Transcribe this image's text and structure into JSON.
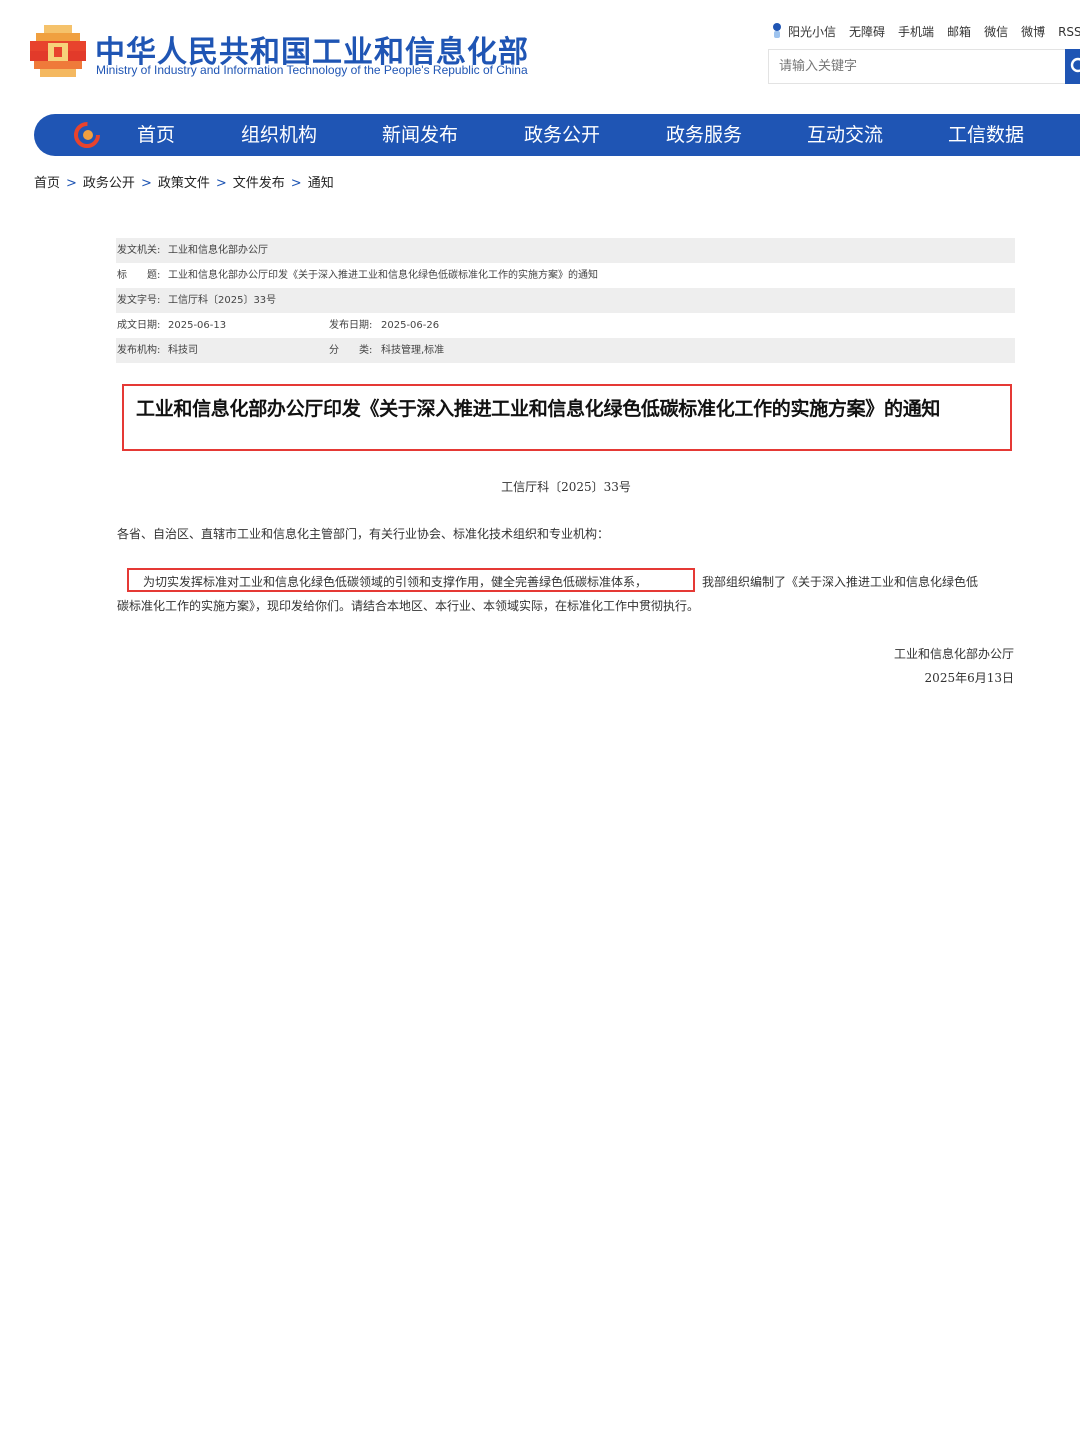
{
  "header": {
    "logo_cn": "中华人民共和国工业和信息化部",
    "logo_en": "Ministry of Industry and Information Technology of the People's Republic of China",
    "top_links": [
      "阳光小信",
      "无障碍",
      "手机端",
      "邮箱",
      "微信",
      "微博",
      "RSS订"
    ],
    "search_placeholder": "请输入关键字"
  },
  "nav": {
    "items": [
      "首页",
      "组织机构",
      "新闻发布",
      "政务公开",
      "政务服务",
      "互动交流",
      "工信数据"
    ]
  },
  "breadcrumb": [
    "首页",
    "政务公开",
    "政策文件",
    "文件发布",
    "通知"
  ],
  "info": {
    "issuer_label": "发文机关:",
    "issuer": "工业和信息化部办公厅",
    "title_label": "标　　题:",
    "title": "工业和信息化部办公厅印发《关于深入推进工业和信息化绿色低碳标准化工作的实施方案》的通知",
    "doc_no_label": "发文字号:",
    "doc_no": "工信厅科〔2025〕33号",
    "written_label": "成文日期:",
    "written": "2025-06-13",
    "published_label": "发布日期:",
    "published": "2025-06-26",
    "org_label": "发布机构:",
    "org": "科技司",
    "category_label": "分　　类:",
    "category": "科技管理,标准"
  },
  "document": {
    "title": "工业和信息化部办公厅印发《关于深入推进工业和信息化绿色低碳标准化工作的实施方案》的通知",
    "number": "工信厅科〔2025〕33号",
    "salutation": "各省、自治区、直辖市工业和信息化主管部门，有关行业协会、标准化技术组织和专业机构：",
    "para_highlight": "为切实发挥标准对工业和信息化绿色低碳领域的引领和支撑作用，健全完善绿色低碳标准体系，",
    "para_rest_line1": "我部组织编制了《关于深入推进工业和信息化绿色低",
    "para_rest_line2": "碳标准化工作的实施方案》，现印发给你们。请结合本地区、本行业、本领域实际，在标准化工作中贯彻执行。",
    "sign_org": "工业和信息化部办公厅",
    "sign_date": "2025年6月13日"
  },
  "colors": {
    "brand_blue": "#1f55b4",
    "highlight_red": "#e53935"
  }
}
